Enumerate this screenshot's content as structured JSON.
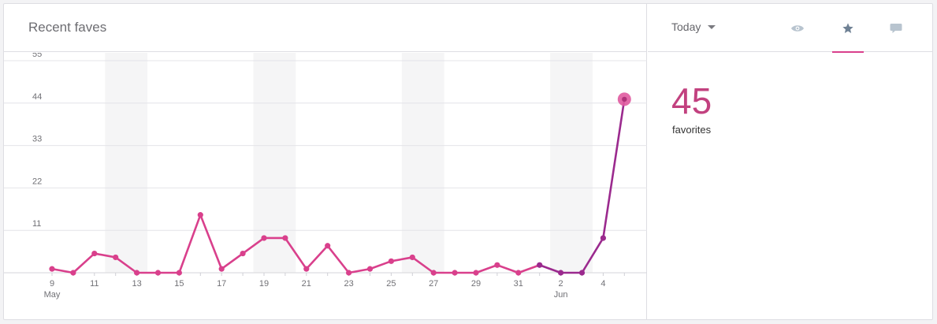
{
  "header": {
    "title": "Recent faves"
  },
  "controls": {
    "period_label": "Today",
    "tabs": [
      {
        "name": "views",
        "icon": "eye-icon",
        "active": false
      },
      {
        "name": "faves",
        "icon": "star-icon",
        "active": true
      },
      {
        "name": "comments",
        "icon": "comment-icon",
        "active": false
      }
    ]
  },
  "stat": {
    "value": "45",
    "label": "favorites"
  },
  "colors": {
    "accent": "#d9408c",
    "recent": "#9b2a8e",
    "highlight": "#e05aa0"
  },
  "chart_data": {
    "type": "line",
    "ylim": [
      0,
      55
    ],
    "yticks": [
      "55",
      "44",
      "33",
      "22",
      "11"
    ],
    "x": [
      "May 9",
      "May 10",
      "May 11",
      "May 12",
      "May 13",
      "May 14",
      "May 15",
      "May 16",
      "May 17",
      "May 18",
      "May 19",
      "May 20",
      "May 21",
      "May 22",
      "May 23",
      "May 24",
      "May 25",
      "May 26",
      "May 27",
      "May 28",
      "May 29",
      "May 30",
      "May 31",
      "Jun 1",
      "Jun 2",
      "Jun 3",
      "Jun 4",
      "Jun 5"
    ],
    "values": [
      1,
      0,
      5,
      4,
      0,
      0,
      0,
      15,
      1,
      5,
      9,
      9,
      1,
      7,
      0,
      1,
      3,
      4,
      0,
      0,
      0,
      2,
      0,
      2,
      0,
      0,
      9,
      45
    ],
    "xtick_labels": [
      {
        "index": 0,
        "day": "9",
        "month": "May"
      },
      {
        "index": 2,
        "day": "11"
      },
      {
        "index": 4,
        "day": "13"
      },
      {
        "index": 6,
        "day": "15"
      },
      {
        "index": 8,
        "day": "17"
      },
      {
        "index": 10,
        "day": "19"
      },
      {
        "index": 12,
        "day": "21"
      },
      {
        "index": 14,
        "day": "23"
      },
      {
        "index": 16,
        "day": "25"
      },
      {
        "index": 18,
        "day": "27"
      },
      {
        "index": 20,
        "day": "29"
      },
      {
        "index": 22,
        "day": "31"
      },
      {
        "index": 24,
        "day": "2",
        "month": "Jun"
      },
      {
        "index": 26,
        "day": "4"
      }
    ],
    "weekend_bands": [
      [
        2.5,
        4.5
      ],
      [
        9.5,
        11.5
      ],
      [
        16.5,
        18.5
      ],
      [
        23.5,
        25.5
      ]
    ],
    "recent_from_index": 23,
    "highlight_index": 27,
    "grid": true
  }
}
